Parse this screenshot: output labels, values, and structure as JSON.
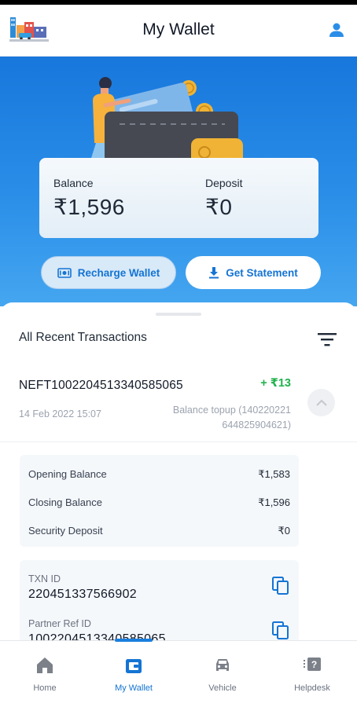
{
  "header": {
    "title": "My Wallet"
  },
  "wallet": {
    "balance_label": "Balance",
    "balance_value": "₹1,596",
    "deposit_label": "Deposit",
    "deposit_value": "₹0"
  },
  "actions": {
    "recharge_label": "Recharge Wallet",
    "statement_label": "Get Statement"
  },
  "transactions": {
    "title": "All Recent Transactions",
    "items": [
      {
        "id": "NEFT100220451334058506​5",
        "amount": "+ ₹13",
        "date": "14 Feb 2022 15:07",
        "description_line1": "Balance topup (140220221",
        "description_line2": "644825904621)",
        "opening_balance_label": "Opening Balance",
        "opening_balance": "₹1,583",
        "closing_balance_label": "Closing Balance",
        "closing_balance": "₹1,596",
        "security_deposit_label": "Security Deposit",
        "security_deposit": "₹0",
        "txn_id_label": "TXN ID",
        "txn_id": "220451337566902",
        "partner_ref_label": "Partner Ref ID",
        "partner_ref": "100220451334058506​5"
      }
    ]
  },
  "nav": {
    "items": [
      {
        "label": "Home"
      },
      {
        "label": "My Wallet"
      },
      {
        "label": "Vehicle"
      },
      {
        "label": "Helpdesk"
      }
    ],
    "active": "My Wallet"
  },
  "colors": {
    "primary": "#1877dc",
    "credit": "#22b24c",
    "active_nav": "#1474d4"
  },
  "icons": [
    "brand-logo",
    "user-icon",
    "wallet-illustration",
    "recharge-icon",
    "download-icon",
    "filter-icon",
    "chevron-up-icon",
    "copy-icon",
    "home-icon",
    "wallet-icon",
    "car-icon",
    "helpdesk-icon"
  ]
}
